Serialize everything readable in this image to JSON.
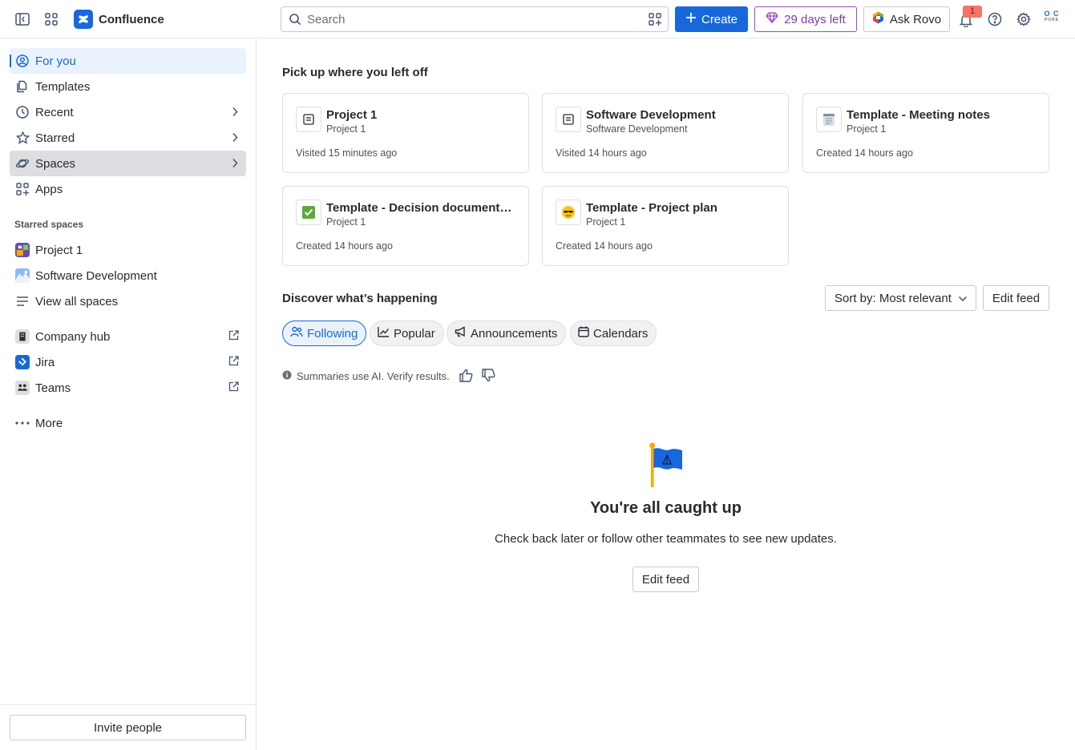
{
  "app": {
    "name": "Confluence"
  },
  "header": {
    "search_placeholder": "Search",
    "create_label": "Create",
    "trial_label": "29 days left",
    "rovo_label": "Ask Rovo",
    "notification_count": "1",
    "avatar_initials_top": "O C",
    "avatar_initials_bottom": "PURE"
  },
  "sidebar": {
    "items": [
      {
        "label": "For you"
      },
      {
        "label": "Templates"
      },
      {
        "label": "Recent"
      },
      {
        "label": "Starred"
      },
      {
        "label": "Spaces"
      },
      {
        "label": "Apps"
      }
    ],
    "starred_spaces_label": "Starred spaces",
    "spaces": [
      {
        "label": "Project 1"
      },
      {
        "label": "Software Development"
      },
      {
        "label": "View all spaces"
      }
    ],
    "external": [
      {
        "label": "Company hub"
      },
      {
        "label": "Jira"
      },
      {
        "label": "Teams"
      }
    ],
    "more_label": "More",
    "invite_label": "Invite people"
  },
  "main": {
    "recent_title": "Pick up where you left off",
    "cards": [
      {
        "title": "Project 1",
        "space": "Project 1",
        "meta": "Visited 15 minutes ago",
        "icon": "page-icon"
      },
      {
        "title": "Software Development",
        "space": "Software Development",
        "meta": "Visited 14 hours ago",
        "icon": "page-icon"
      },
      {
        "title": "Template - Meeting notes",
        "space": "Project 1",
        "meta": "Created 14 hours ago",
        "icon": "notepad-icon"
      },
      {
        "title": "Template - Decision documenta...",
        "space": "Project 1",
        "meta": "Created 14 hours ago",
        "icon": "check-mark-icon"
      },
      {
        "title": "Template - Project plan",
        "space": "Project 1",
        "meta": "Created 14 hours ago",
        "icon": "sunglasses-icon"
      }
    ],
    "discover_title": "Discover what’s happening",
    "sort_label": "Sort by: Most relevant",
    "edit_feed_label": "Edit feed",
    "filters": [
      {
        "label": "Following",
        "selected": true
      },
      {
        "label": "Popular",
        "selected": false
      },
      {
        "label": "Announcements",
        "selected": false
      },
      {
        "label": "Calendars",
        "selected": false
      }
    ],
    "ai_note": "Summaries use AI. Verify results.",
    "empty_title": "You're all caught up",
    "empty_subtitle": "Check back later or follow other teammates to see new updates.",
    "empty_button": "Edit feed"
  },
  "colors": {
    "brand": "#1868db",
    "trial": "#964ac0",
    "badge": "#f87168"
  }
}
